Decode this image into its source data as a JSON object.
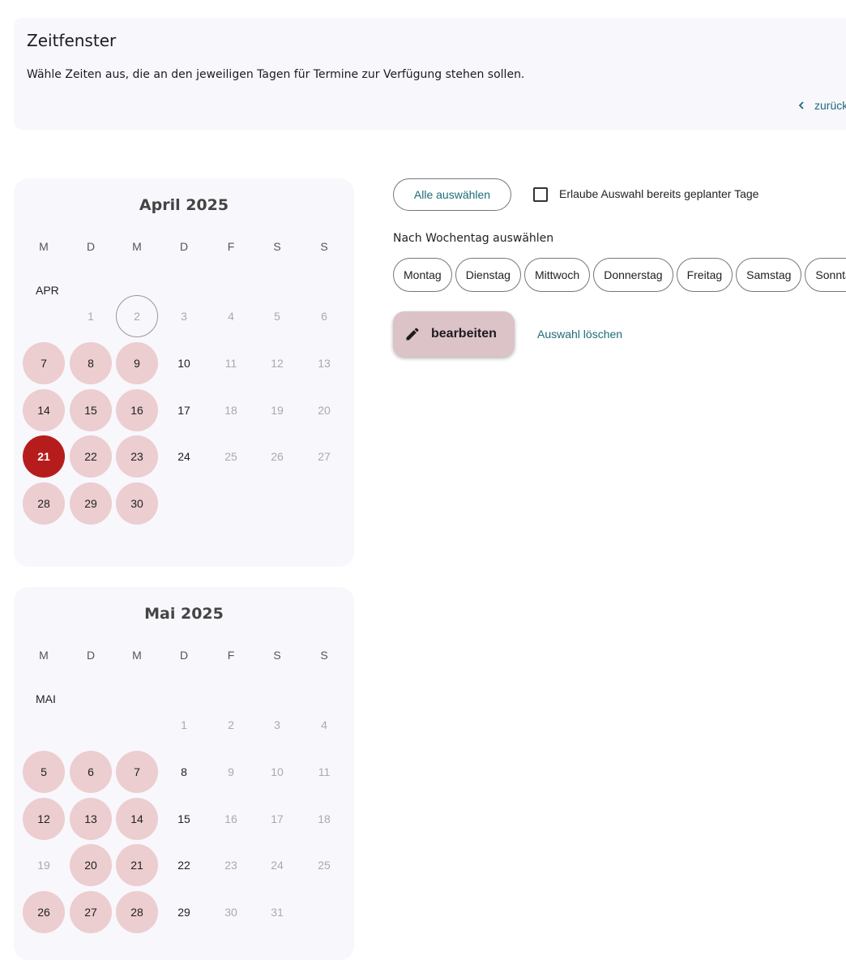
{
  "header": {
    "title": "Zeitfenster",
    "description": "Wähle Zeiten aus, die an den jeweiligen Tagen für Termine zur Verfügung stehen sollen.",
    "back_label": "zurück"
  },
  "controls": {
    "select_all_label": "Alle auswählen",
    "allow_planned_label": "Erlaube Auswahl bereits geplanter Tage",
    "allow_planned_checked": false,
    "weekday_heading": "Nach Wochentag auswählen",
    "weekday_chips": [
      "Montag",
      "Dienstag",
      "Mittwoch",
      "Donnerstag",
      "Freitag",
      "Samstag",
      "Sonntag"
    ],
    "edit_label": "bearbeiten",
    "edit_icon": "pencil-icon",
    "clear_label": "Auswahl löschen",
    "back_icon": "chevron-left-icon"
  },
  "colors": {
    "accent_link": "#1e6b7a",
    "selected_day": "#eccdd0",
    "active_day": "#b71c1c",
    "edit_button": "#dcc3c8"
  },
  "weekday_headers": [
    "M",
    "D",
    "M",
    "D",
    "F",
    "S",
    "S"
  ],
  "calendars": [
    {
      "title": "April 2025",
      "month_label": "APR",
      "weeks": [
        [
          null,
          {
            "d": "1",
            "s": "disabled"
          },
          {
            "d": "2",
            "s": "today"
          },
          {
            "d": "3",
            "s": "disabled"
          },
          {
            "d": "4",
            "s": "disabled"
          },
          {
            "d": "5",
            "s": "disabled"
          },
          {
            "d": "6",
            "s": "disabled"
          }
        ],
        [
          {
            "d": "7",
            "s": "selected"
          },
          {
            "d": "8",
            "s": "selected"
          },
          {
            "d": "9",
            "s": "selected"
          },
          {
            "d": "10",
            "s": "available"
          },
          {
            "d": "11",
            "s": "disabled"
          },
          {
            "d": "12",
            "s": "disabled"
          },
          {
            "d": "13",
            "s": "disabled"
          }
        ],
        [
          {
            "d": "14",
            "s": "selected"
          },
          {
            "d": "15",
            "s": "selected"
          },
          {
            "d": "16",
            "s": "selected"
          },
          {
            "d": "17",
            "s": "available"
          },
          {
            "d": "18",
            "s": "disabled"
          },
          {
            "d": "19",
            "s": "disabled"
          },
          {
            "d": "20",
            "s": "disabled"
          }
        ],
        [
          {
            "d": "21",
            "s": "active"
          },
          {
            "d": "22",
            "s": "selected"
          },
          {
            "d": "23",
            "s": "selected"
          },
          {
            "d": "24",
            "s": "available"
          },
          {
            "d": "25",
            "s": "disabled"
          },
          {
            "d": "26",
            "s": "disabled"
          },
          {
            "d": "27",
            "s": "disabled"
          }
        ],
        [
          {
            "d": "28",
            "s": "selected"
          },
          {
            "d": "29",
            "s": "selected"
          },
          {
            "d": "30",
            "s": "selected"
          },
          null,
          null,
          null,
          null
        ]
      ]
    },
    {
      "title": "Mai 2025",
      "month_label": "MAI",
      "weeks": [
        [
          null,
          null,
          null,
          {
            "d": "1",
            "s": "disabled"
          },
          {
            "d": "2",
            "s": "disabled"
          },
          {
            "d": "3",
            "s": "disabled"
          },
          {
            "d": "4",
            "s": "disabled"
          }
        ],
        [
          {
            "d": "5",
            "s": "selected"
          },
          {
            "d": "6",
            "s": "selected"
          },
          {
            "d": "7",
            "s": "selected"
          },
          {
            "d": "8",
            "s": "available"
          },
          {
            "d": "9",
            "s": "disabled"
          },
          {
            "d": "10",
            "s": "disabled"
          },
          {
            "d": "11",
            "s": "disabled"
          }
        ],
        [
          {
            "d": "12",
            "s": "selected"
          },
          {
            "d": "13",
            "s": "selected"
          },
          {
            "d": "14",
            "s": "selected"
          },
          {
            "d": "15",
            "s": "available"
          },
          {
            "d": "16",
            "s": "disabled"
          },
          {
            "d": "17",
            "s": "disabled"
          },
          {
            "d": "18",
            "s": "disabled"
          }
        ],
        [
          {
            "d": "19",
            "s": "disabled"
          },
          {
            "d": "20",
            "s": "selected"
          },
          {
            "d": "21",
            "s": "selected"
          },
          {
            "d": "22",
            "s": "available"
          },
          {
            "d": "23",
            "s": "disabled"
          },
          {
            "d": "24",
            "s": "disabled"
          },
          {
            "d": "25",
            "s": "disabled"
          }
        ],
        [
          {
            "d": "26",
            "s": "selected"
          },
          {
            "d": "27",
            "s": "selected"
          },
          {
            "d": "28",
            "s": "selected"
          },
          {
            "d": "29",
            "s": "available"
          },
          {
            "d": "30",
            "s": "disabled"
          },
          {
            "d": "31",
            "s": "disabled"
          },
          null
        ]
      ]
    }
  ]
}
